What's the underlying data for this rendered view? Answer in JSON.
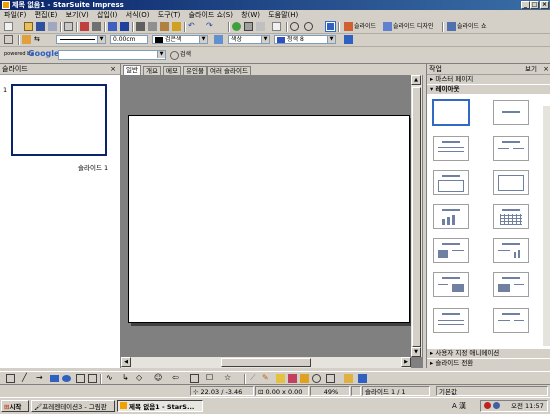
{
  "window": {
    "title": "제목 없음1 - StarSuite Impress"
  },
  "menu": [
    "파일(F)",
    "편집(E)",
    "보기(V)",
    "삽입(I)",
    "서식(O)",
    "도구(T)",
    "슬라이드 쇼(S)",
    "창(W)",
    "도움말(H)"
  ],
  "toolbar1": {
    "slide_btn": "슬라이드",
    "slide_design_btn": "슬라이드 디자인",
    "slideshow_btn": "슬라이드 쇼"
  },
  "toolbar2": {
    "line_width": "0.00cm",
    "line_color": "검은색",
    "fill_mode": "색상",
    "fill_color": "청색 8"
  },
  "toolbar3": {
    "search_label": "검색"
  },
  "left_panel": {
    "title": "슬라이드",
    "slide_number": "1",
    "slide_label": "슬라이드 1"
  },
  "tabs": [
    "일반",
    "개요",
    "메모",
    "유인물",
    "여러 슬라이드"
  ],
  "right_panel": {
    "title": "작업",
    "view_label": "보기",
    "sections": {
      "master": "마스터 페이지",
      "layout": "레이아웃",
      "animation": "사용자 지정 애니메이션",
      "transition": "슬라이드 전환"
    }
  },
  "statusbar": {
    "position": "22.03 / -3.46",
    "size": "0.00 x 0.00",
    "zoom": "49%",
    "page": "슬라이드 1 / 1",
    "master": "기본값"
  },
  "taskbar": {
    "start": "시작",
    "task1": "프레젠테이션3 - 그림판",
    "task2": "제목 없음1 - StarS...",
    "ime": "A 漢 ",
    "clock": "오전 11:57"
  },
  "colors": {
    "accent": "#0a246a",
    "canvas_bg": "#808080",
    "select": "#316ac5"
  }
}
